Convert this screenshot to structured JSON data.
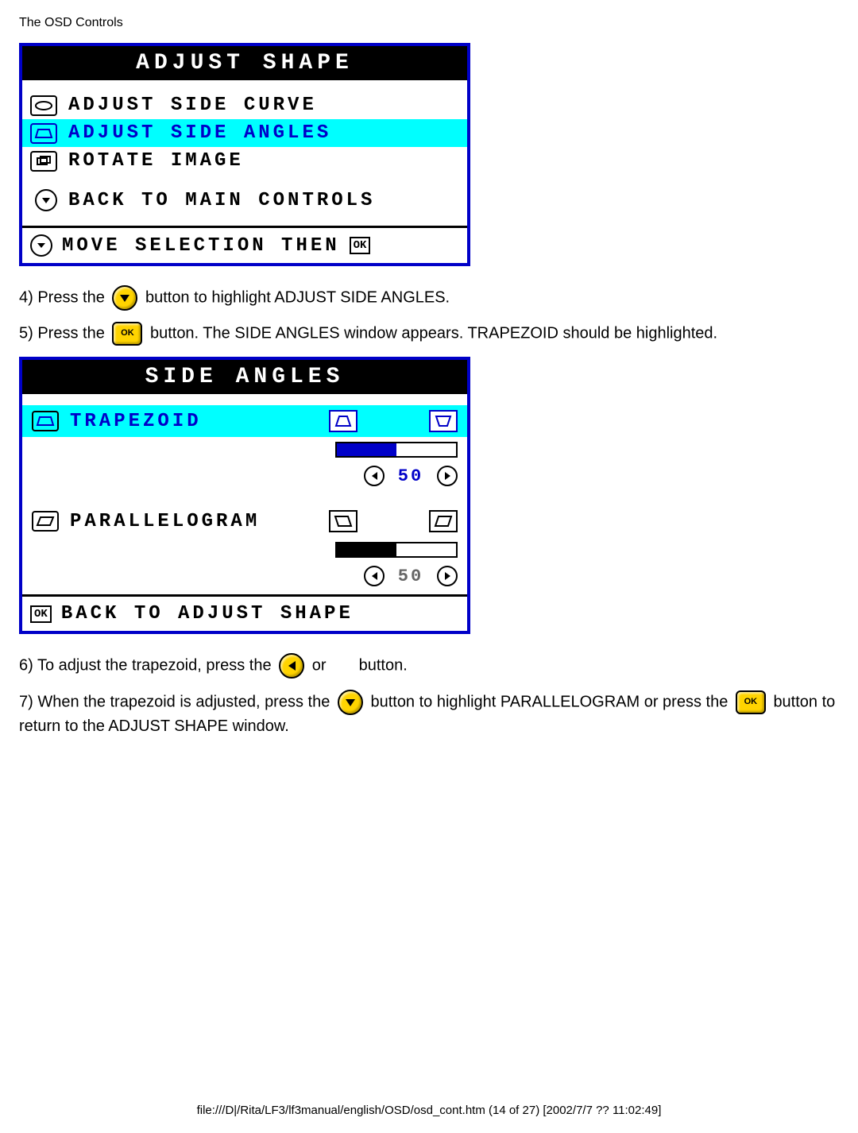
{
  "page_header": "The OSD Controls",
  "adjust_shape": {
    "title": "ADJUST SHAPE",
    "items": [
      {
        "label": "ADJUST SIDE CURVE",
        "highlighted": false
      },
      {
        "label": "ADJUST SIDE ANGLES",
        "highlighted": true
      },
      {
        "label": "ROTATE IMAGE",
        "highlighted": false
      }
    ],
    "back": "BACK TO MAIN CONTROLS",
    "footer": "MOVE SELECTION THEN",
    "footer_ok": "OK"
  },
  "step4": {
    "prefix": "4) Press the ",
    "suffix": " button to highlight ADJUST SIDE ANGLES."
  },
  "step5": {
    "prefix": "5) Press the ",
    "suffix": " button. The SIDE ANGLES window appears. TRAPEZOID should be highlighted."
  },
  "side_angles": {
    "title": "SIDE ANGLES",
    "trapezoid": {
      "label": "TRAPEZOID",
      "value": "50",
      "fill_pct": 50,
      "highlighted": true
    },
    "parallelogram": {
      "label": "PARALLELOGRAM",
      "value": "50",
      "fill_pct": 50,
      "highlighted": false
    },
    "back": "BACK TO ADJUST SHAPE",
    "ok": "OK"
  },
  "step6": {
    "prefix": "6) To adjust the trapezoid, press the ",
    "mid": " or ",
    "suffix": " button."
  },
  "step7": {
    "prefix": "7) When the trapezoid is adjusted, press the ",
    "mid": " button to highlight PARALLELOGRAM or press the ",
    "suffix": " button to return to the ADJUST SHAPE window."
  },
  "footer_path": "file:///D|/Rita/LF3/lf3manual/english/OSD/osd_cont.htm (14 of 27) [2002/7/7 ?? 11:02:49]"
}
